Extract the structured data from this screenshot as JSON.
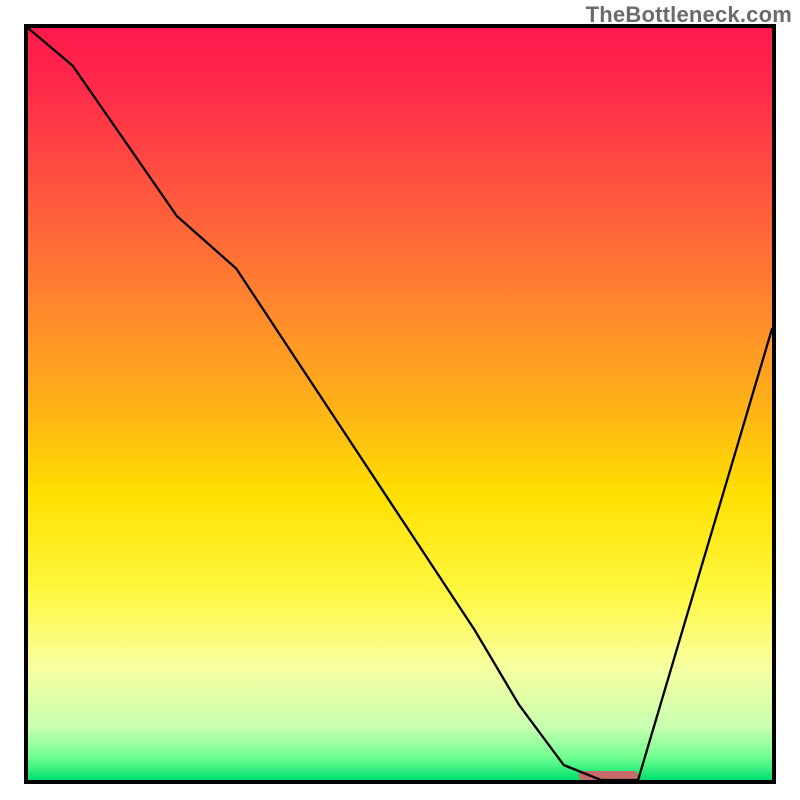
{
  "watermark": "TheBottleneck.com",
  "chart_data": {
    "type": "line",
    "title": "",
    "xlabel": "",
    "ylabel": "",
    "xlim": [
      0,
      100
    ],
    "ylim": [
      0,
      100
    ],
    "grid": false,
    "legend": false,
    "axes_visible": false,
    "background_gradient": {
      "stops": [
        {
          "pos": 0.0,
          "color": "#ff1a4d"
        },
        {
          "pos": 0.08,
          "color": "#ff2a4a"
        },
        {
          "pos": 0.2,
          "color": "#ff5040"
        },
        {
          "pos": 0.35,
          "color": "#ff8030"
        },
        {
          "pos": 0.5,
          "color": "#ffb018"
        },
        {
          "pos": 0.62,
          "color": "#ffe000"
        },
        {
          "pos": 0.75,
          "color": "#fff840"
        },
        {
          "pos": 0.85,
          "color": "#f8ffa0"
        },
        {
          "pos": 0.93,
          "color": "#c8ffb0"
        },
        {
          "pos": 0.97,
          "color": "#70ff90"
        },
        {
          "pos": 1.0,
          "color": "#00e070"
        }
      ]
    },
    "series": [
      {
        "name": "bottleneck-curve",
        "color": "#000000",
        "width": 2.3,
        "x": [
          0,
          6,
          20,
          28,
          40,
          52,
          60,
          66,
          72,
          77,
          82,
          88,
          94,
          100
        ],
        "values": [
          100,
          95,
          75,
          68,
          50,
          32,
          20,
          10,
          2,
          0,
          0,
          20,
          40,
          60
        ]
      }
    ],
    "marker": {
      "name": "optimal-range",
      "color": "#c96a6a",
      "x_start": 74,
      "x_end": 82,
      "y": 0.6,
      "height": 1.2,
      "rx": 0.6
    },
    "frame_border": {
      "color": "#000000",
      "width": 4
    }
  }
}
